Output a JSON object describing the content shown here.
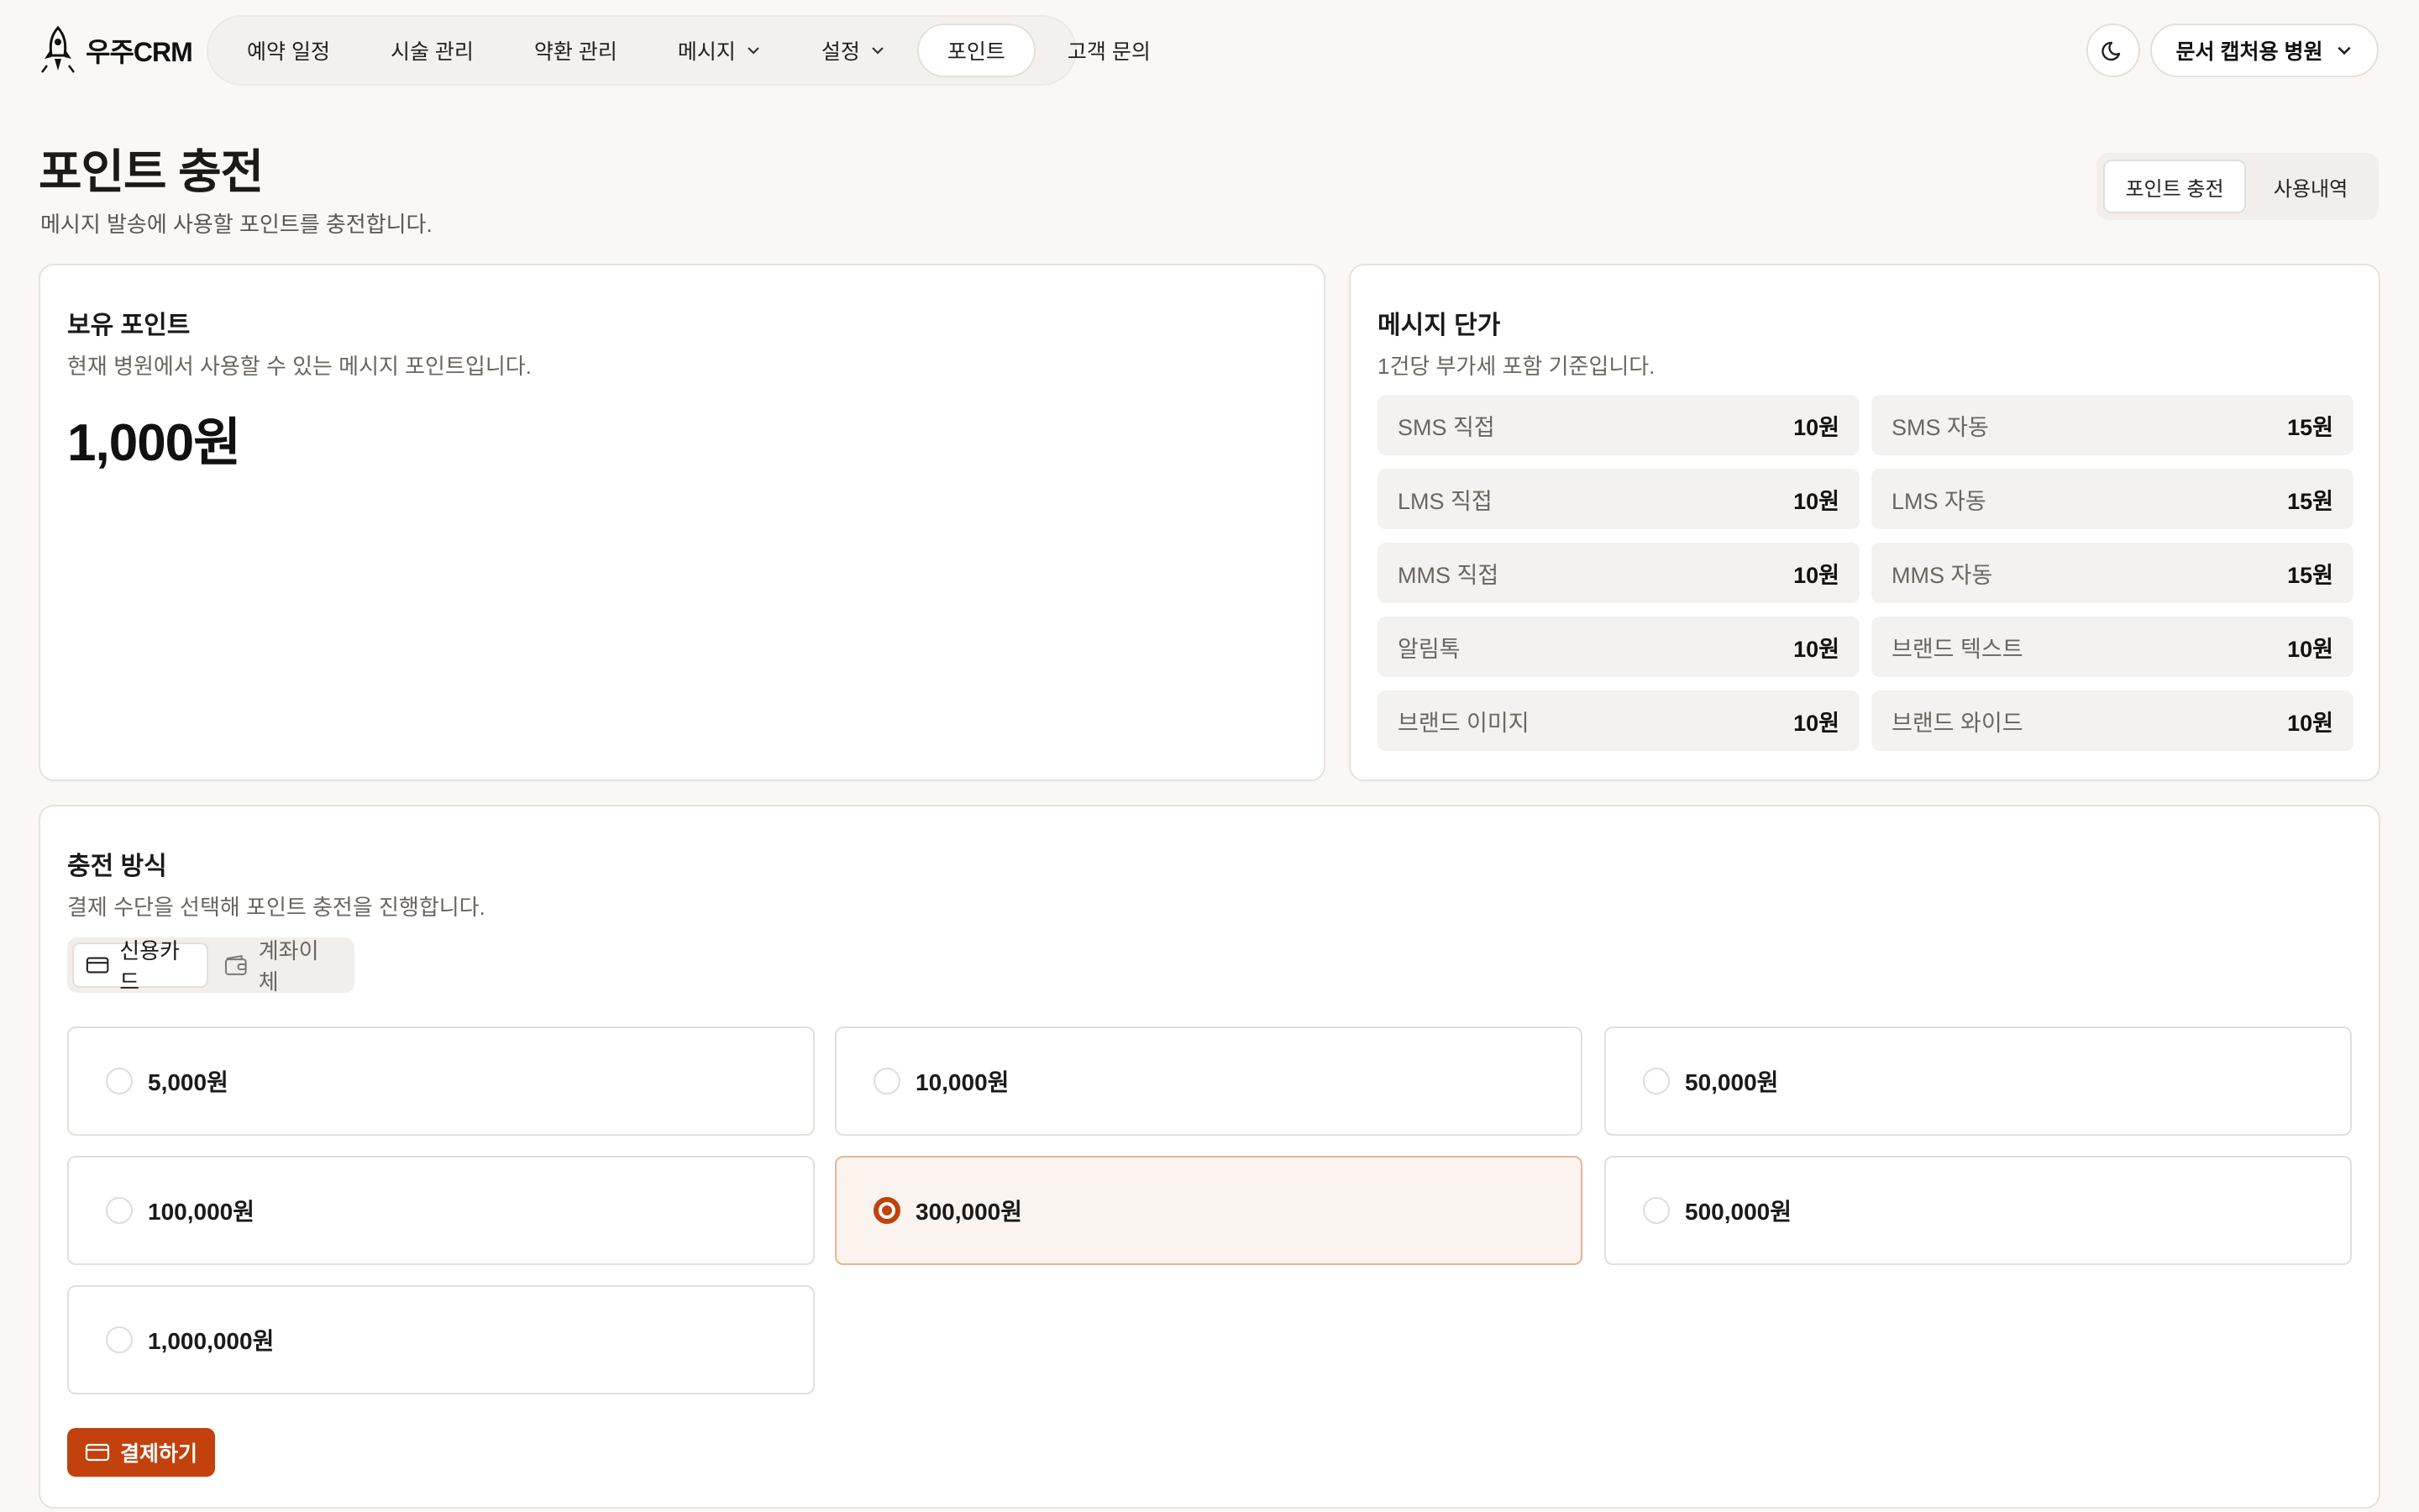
{
  "app": {
    "logo_text": "우주CRM"
  },
  "nav": {
    "items": [
      {
        "label": "예약 일정"
      },
      {
        "label": "시술 관리"
      },
      {
        "label": "약환 관리"
      },
      {
        "label": "메시지"
      },
      {
        "label": "설정"
      },
      {
        "label": "포인트"
      },
      {
        "label": "고객 문의"
      }
    ],
    "active": "포인트"
  },
  "header": {
    "clinic_name": "문서 캡처용 병원"
  },
  "page": {
    "title": "포인트 충전",
    "subtitle": "메시지 발송에 사용할 포인트를 충전합니다.",
    "tabs": [
      {
        "label": "포인트 충전"
      },
      {
        "label": "사용내역"
      }
    ],
    "active_tab": "포인트 충전"
  },
  "balance_card": {
    "title": "보유 포인트",
    "subtitle": "현재 병원에서 사용할 수 있는 메시지 포인트입니다.",
    "amount": "1,000원"
  },
  "price_card": {
    "title": "메시지 단가",
    "subtitle": "1건당 부가세 포함 기준입니다.",
    "prices": [
      {
        "label": "SMS 직접",
        "value": "10원"
      },
      {
        "label": "SMS 자동",
        "value": "15원"
      },
      {
        "label": "LMS 직접",
        "value": "10원"
      },
      {
        "label": "LMS 자동",
        "value": "15원"
      },
      {
        "label": "MMS 직접",
        "value": "10원"
      },
      {
        "label": "MMS 자동",
        "value": "15원"
      },
      {
        "label": "알림톡",
        "value": "10원"
      },
      {
        "label": "브랜드 텍스트",
        "value": "10원"
      },
      {
        "label": "브랜드 이미지",
        "value": "10원"
      },
      {
        "label": "브랜드 와이드",
        "value": "10원"
      }
    ]
  },
  "charge_card": {
    "title": "충전 방식",
    "subtitle": "결제 수단을 선택해 포인트 충전을 진행합니다.",
    "methods": [
      {
        "label": "신용카드"
      },
      {
        "label": "계좌이체"
      }
    ],
    "active_method": "신용카드",
    "amounts": [
      {
        "label": "5,000원"
      },
      {
        "label": "10,000원"
      },
      {
        "label": "50,000원"
      },
      {
        "label": "100,000원"
      },
      {
        "label": "300,000원"
      },
      {
        "label": "500,000원"
      },
      {
        "label": "1,000,000원"
      }
    ],
    "selected_amount": "300,000원",
    "pay_button": "결제하기"
  },
  "colors": {
    "accent": "#c2410c",
    "background": "#f9f8f7",
    "selected_bg": "#fbf3ee"
  }
}
